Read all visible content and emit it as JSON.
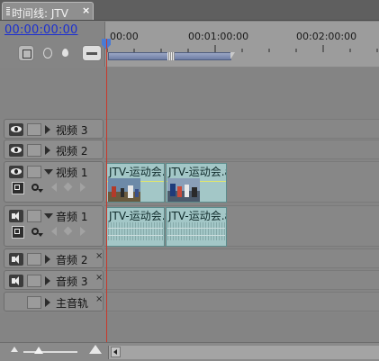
{
  "panel": {
    "tab_title": "时间线: JTV",
    "close_glyph": "×"
  },
  "timeline": {
    "timecode": "00:00:00:00",
    "ruler_labels": [
      "00:00",
      "00:01:00:00",
      "00:02:00:00"
    ]
  },
  "tracks": [
    {
      "name": "视频 3",
      "kind": "video",
      "expanded": false
    },
    {
      "name": "视频 2",
      "kind": "video",
      "expanded": false
    },
    {
      "name": "视频 1",
      "kind": "video",
      "expanded": true
    },
    {
      "name": "音频 1",
      "kind": "audio",
      "expanded": true
    },
    {
      "name": "音频 2",
      "kind": "audio",
      "expanded": false
    },
    {
      "name": "音频 3",
      "kind": "audio",
      "expanded": false
    },
    {
      "name": "主音轨",
      "kind": "master",
      "expanded": false
    }
  ],
  "clips": {
    "video": [
      "JTV-运动会.a",
      "JTV-运动会.a"
    ],
    "audio": [
      "JTV-运动会.a",
      "JTV-运动会.a"
    ]
  },
  "icons": {
    "eye": "eye-icon",
    "speaker": "speaker-icon",
    "lock": "lock-toggle",
    "expander": "triangle-icon",
    "mute": "mute-x-icon"
  },
  "colors": {
    "timecode": "#1b2fd1",
    "playhead": "#c8392b",
    "clip_fill": "#a3c7c7"
  }
}
